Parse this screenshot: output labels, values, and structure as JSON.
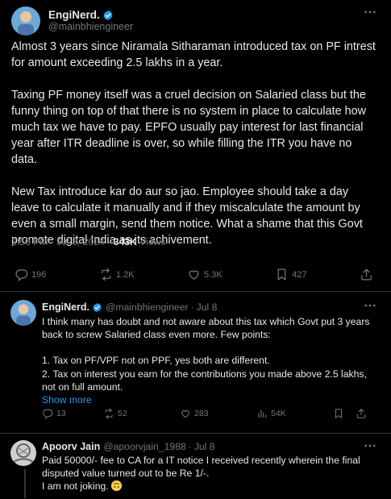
{
  "main_tweet": {
    "name": "EngiNerd.",
    "handle": "@mainbhiengineer",
    "paragraphs": [
      "Almost 3 years since Niramala Sitharaman introduced tax on PF intrest for amount exceeding 2.5 lakhs in a year.",
      "Taxing PF money itself was a cruel decision on Salaried class but the funny thing on top of that there is no system in place to calculate how much tax we have to pay. EPFO usually pay interest for last financial year after ITR deadline is over, so while filling the ITR you have no data.",
      "New Tax introduce kar do aur so jao. Employee should take a day leave to calculate it manually and if they miscalculate the amount by even a small margin, send them notice. What a shame that this Govt promote digital India as its achivement."
    ],
    "time": "2:50 PM",
    "date": "Jul 8, 2024",
    "views": "343K",
    "views_label": "Views",
    "replies": "196",
    "reposts": "1.2K",
    "likes": "5.3K",
    "bookmarks": "427"
  },
  "reply1": {
    "name": "EngiNerd.",
    "handle": "@mainbhiengineer",
    "date": "Jul 8",
    "lines": [
      "I think many has doubt and not aware about this tax which Govt put 3 years back to screw Salaried class even more. Few points:",
      "1. Tax on PF/VPF not on PPF, yes both are different.",
      "2. Tax on interest you earn for the contributions you made above 2.5 lakhs, not on full amount."
    ],
    "show_more": "Show more",
    "replies": "13",
    "reposts": "52",
    "likes": "283",
    "views": "54K"
  },
  "reply2": {
    "name": "Apoorv Jain",
    "handle": "@apoorvjain_1988",
    "date": "Jul 8",
    "text": "Paid 50000/- fee to CA for a IT notice I received recently wherein the final disputed value turned out to be Re 1/-.",
    "text2": "I am not joking."
  },
  "separator": "·",
  "colors": {
    "verified": "#1d9bf0",
    "muted": "#71767b",
    "text": "#e7e9ea",
    "background": "#000000"
  }
}
